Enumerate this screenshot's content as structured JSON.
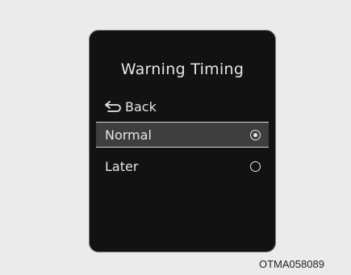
{
  "screen": {
    "title": "Warning Timing",
    "back_label": "Back",
    "options": [
      {
        "label": "Normal",
        "selected": true
      },
      {
        "label": "Later",
        "selected": false
      }
    ]
  },
  "caption": "OTMA058089",
  "icons": {
    "back": "back-arrow-icon",
    "radio_selected": "radio-selected-icon",
    "radio_unselected": "radio-unselected-icon"
  },
  "colors": {
    "screen_bg": "#121212",
    "highlight_bg": "#3e3e3e",
    "text": "#e6e6e6",
    "page_bg": "#ebebeb"
  }
}
